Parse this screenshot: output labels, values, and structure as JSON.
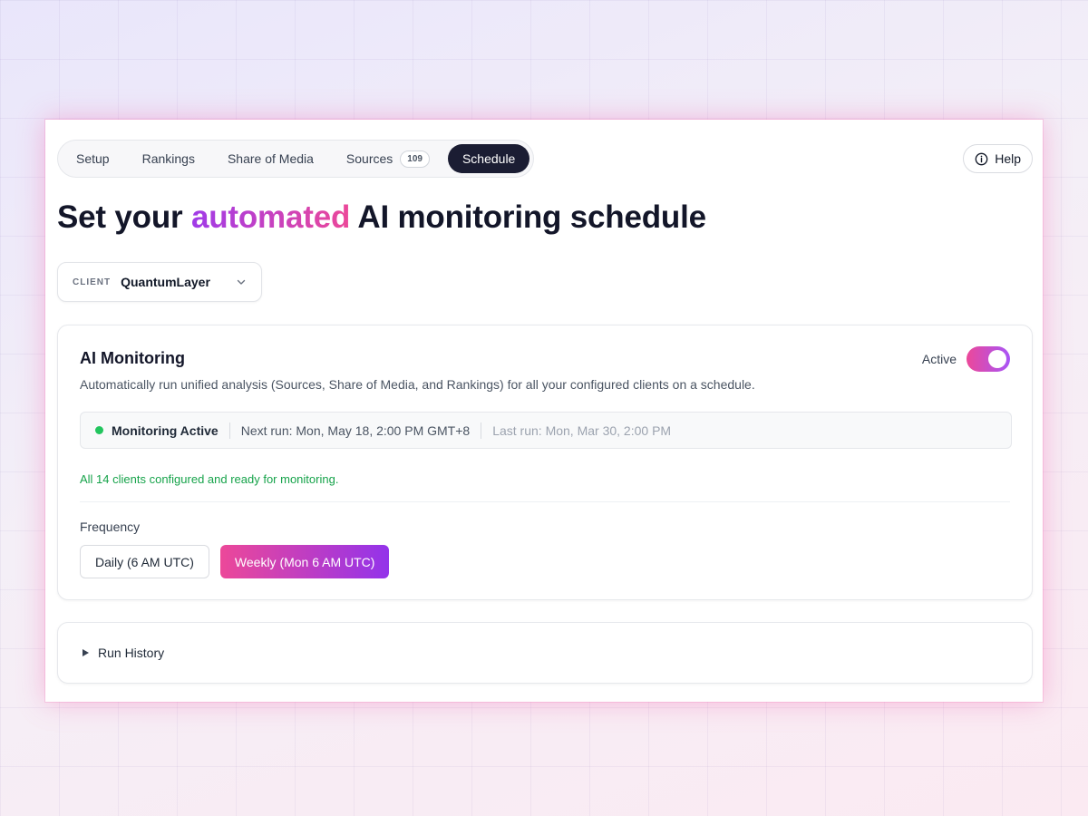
{
  "tabs": [
    {
      "label": "Setup"
    },
    {
      "label": "Rankings"
    },
    {
      "label": "Share of Media"
    },
    {
      "label": "Sources",
      "count": "109"
    },
    {
      "label": "Schedule",
      "active": true
    }
  ],
  "help": {
    "label": "Help",
    "icon": "info-icon"
  },
  "title": {
    "prefix": "Set your ",
    "accent": "automated",
    "suffix": " AI monitoring schedule"
  },
  "client": {
    "label": "CLIENT",
    "value": "QuantumLayer",
    "icon": "chevron-down-icon"
  },
  "monitoring": {
    "title": "AI Monitoring",
    "description": "Automatically run unified analysis (Sources, Share of Media, and Rankings) for all your configured clients on a schedule.",
    "toggle_label": "Active",
    "toggle_on": true,
    "status": {
      "label": "Monitoring Active",
      "next_run": "Next run: Mon, May 18, 2:00 PM GMT+8",
      "last_run": "Last run: Mon, Mar 30, 2:00 PM"
    },
    "ready_note": "All 14 clients configured and ready for monitoring.",
    "frequency": {
      "label": "Frequency",
      "options": [
        "Daily (6 AM UTC)",
        "Weekly (Mon 6 AM UTC)"
      ],
      "selected": "Weekly (Mon 6 AM UTC)"
    }
  },
  "history": {
    "label": "Run History",
    "icon": "caret-right-icon"
  },
  "colors": {
    "accent_pink": "#ec4899",
    "accent_purple": "#a855f7",
    "active_tab": "#1b1d33",
    "status_green": "#22c55e"
  }
}
